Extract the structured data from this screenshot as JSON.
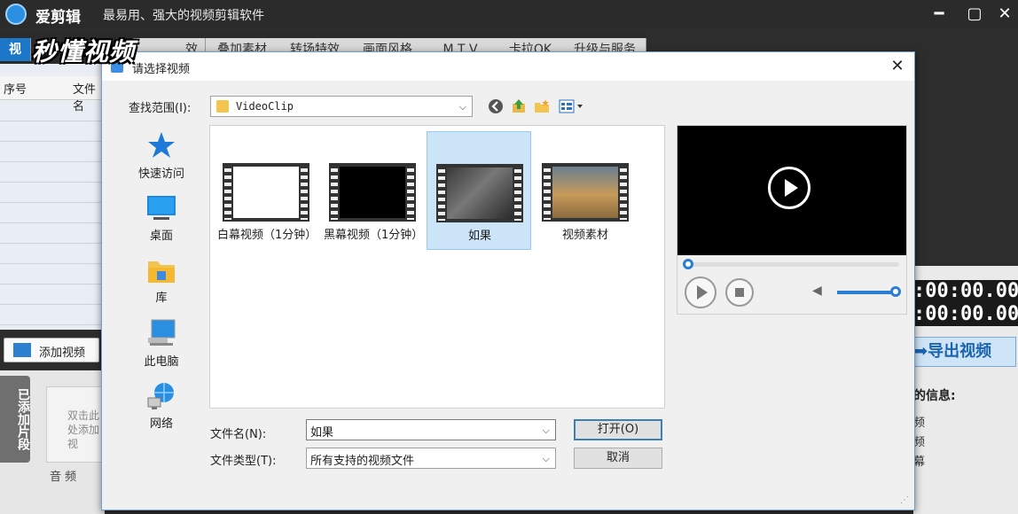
{
  "app": {
    "name": "爱剪辑",
    "slogan": "最易用、强大的视频剪辑软件",
    "tabs": [
      {
        "label": "视"
      },
      {
        "label": "效"
      },
      {
        "label": "叠加素材"
      },
      {
        "label": "转场特效"
      },
      {
        "label": "画面风格"
      },
      {
        "label": "M T V"
      },
      {
        "label": "卡拉OK"
      },
      {
        "label": "升级与服务"
      }
    ],
    "list_headers": {
      "index": "序号",
      "filename": "文件名"
    },
    "add_video_label": "添加视频",
    "clips_tab_label": "已添加片段",
    "add_hint": "双击此处添加视",
    "audio_label": "音 频",
    "time_lines": [
      ":00:00.000",
      ":00:00.000"
    ],
    "export_label": "导出视频",
    "info_title": "的信息:",
    "info_items": [
      "频",
      "频",
      "幕"
    ]
  },
  "watermark": "秒懂视频",
  "dialog": {
    "title": "请选择视频",
    "look_in_label": "查找范围(I):",
    "look_in_value": "VideoClip",
    "places": [
      {
        "label": "快速访问",
        "icon": "star-icon"
      },
      {
        "label": "桌面",
        "icon": "desktop-icon"
      },
      {
        "label": "库",
        "icon": "library-icon"
      },
      {
        "label": "此电脑",
        "icon": "computer-icon"
      },
      {
        "label": "网络",
        "icon": "network-icon"
      }
    ],
    "files": [
      {
        "name": "白幕视频（1分钟）",
        "thumb": "white"
      },
      {
        "name": "黑幕视频（1分钟）",
        "thumb": "black"
      },
      {
        "name": "如果",
        "thumb": "scene-dark",
        "selected": true
      },
      {
        "name": "视频素材",
        "thumb": "scene-sky"
      }
    ],
    "filename_label": "文件名(N):",
    "filename_value": "如果",
    "filetype_label": "文件类型(T):",
    "filetype_value": "所有支持的视频文件",
    "open_label": "打开(O)",
    "cancel_label": "取消"
  },
  "colors": {
    "accent": "#1d77c9",
    "selection": "#cce4f7"
  }
}
